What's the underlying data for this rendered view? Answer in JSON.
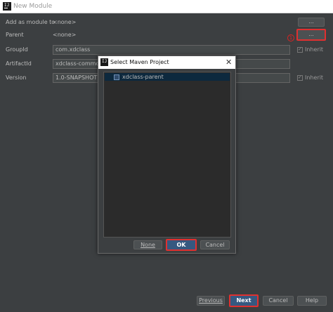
{
  "window": {
    "title": "New Module",
    "app_icon": "IJ"
  },
  "form": {
    "add_as_module_label": "Add as module to",
    "add_as_module_value": "<none>",
    "parent_label": "Parent",
    "parent_value": "<none>",
    "groupid_label": "GroupId",
    "groupid_value": "com.xdclass",
    "artifactid_label": "ArtifactId",
    "artifactid_value": "xdclass-common",
    "version_label": "Version",
    "version_value": "1.0-SNAPSHOT",
    "browse_label": "...",
    "annotation_number": "1",
    "inherit_label": "Inherit"
  },
  "dialog": {
    "title": "Select Maven Project",
    "close": "✕",
    "tree": [
      {
        "label": "xdclass-parent",
        "selected": true
      }
    ],
    "none_label": "None",
    "ok_label": "OK",
    "cancel_label": "Cancel"
  },
  "footer": {
    "previous_label": "Previous",
    "next_label": "Next",
    "cancel_label": "Cancel",
    "help_label": "Help"
  },
  "colors": {
    "background": "#3c3f41",
    "highlight": "#e03030",
    "selection": "#0d293e",
    "default_button": "#365880"
  }
}
